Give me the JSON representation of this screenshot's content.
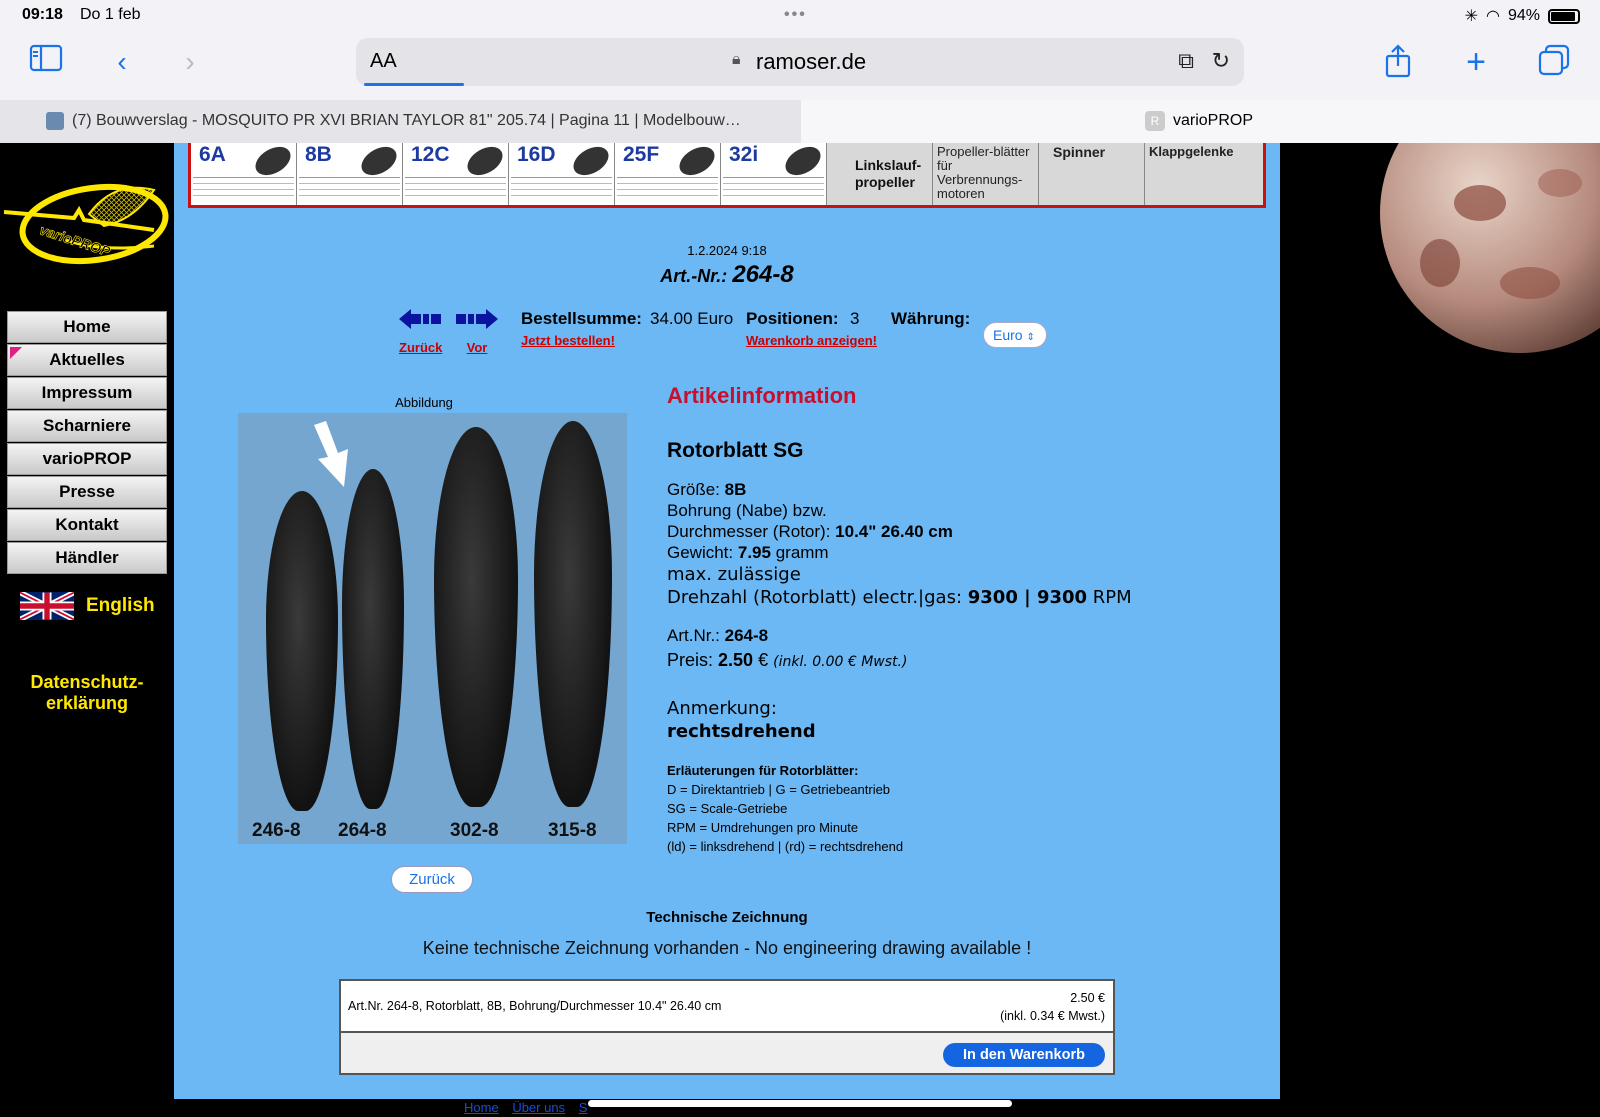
{
  "status": {
    "time": "09:18",
    "date": "Do 1 feb",
    "battery": "94%"
  },
  "browser": {
    "aa": "AA",
    "url": "ramoser.de",
    "tab1_title": "(7) Bouwverslag - MOSQUITO PR XVI BRIAN TAYLOR 81\" 205.74 | Pagina 11 | Modelbouw…",
    "tab2_fav": "R",
    "tab2_title": "varioPROP"
  },
  "sidebar": {
    "logo_text": "varioPROP",
    "items": [
      {
        "label": "Home"
      },
      {
        "label": "Aktuelles"
      },
      {
        "label": "Impressum"
      },
      {
        "label": "Scharniere"
      },
      {
        "label": "varioPROP"
      },
      {
        "label": "Presse"
      },
      {
        "label": "Kontakt"
      },
      {
        "label": "Händler"
      }
    ],
    "english": "English",
    "privacy": "Datenschutz-erklärung"
  },
  "banner": {
    "cells": [
      "6A",
      "8B",
      "12C",
      "16D",
      "25F",
      "32i"
    ],
    "linkslauf": "Linkslauf-propeller",
    "blades_gas": "Propeller-blätter für Verbrennungs-motoren",
    "spinner": "Spinner",
    "klapp": "Klappgelenke"
  },
  "header": {
    "datetime": "1.2.2024 9:18",
    "artnr_label": "Art.-Nr.:",
    "artnr_value": "264-8"
  },
  "orderbar": {
    "back": "Zurück",
    "forward": "Vor",
    "sum_label": "Bestellsumme:",
    "sum_value": "34.00 Euro",
    "order_link": "Jetzt bestellen!",
    "pos_label": "Positionen:",
    "pos_value": "3",
    "cart_link": "Warenkorb anzeigen!",
    "currency_label": "Währung:",
    "currency_value": "Euro"
  },
  "image": {
    "label": "Abbildung",
    "blade_labels": [
      "246-8",
      "264-8",
      "302-8",
      "315-8"
    ],
    "back_button": "Zurück"
  },
  "info": {
    "heading": "Artikelinformation",
    "name": "Rotorblatt SG",
    "size_label": "Größe:",
    "size_value": "8B",
    "bore_label": "Bohrung (Nabe) bzw.",
    "diam_label": "Durchmesser (Rotor):",
    "diam_value": "10.4\" 26.40 cm",
    "weight_label": "Gewicht:",
    "weight_value": "7.95",
    "weight_unit": "gramm",
    "rpm_label1": "max. zulässige",
    "rpm_label2": "Drehzahl (Rotorblatt) electr.|gas:",
    "rpm_value": "9300 | 9300",
    "rpm_unit": "RPM",
    "artnr_label": "Art.Nr.:",
    "artnr_value": "264-8",
    "price_label": "Preis:",
    "price_value": "2.50",
    "price_currency": "€",
    "price_tax": "(inkl. 0.00 € Mwst.)",
    "note_label": "Anmerkung:",
    "note_value": "rechtsdrehend",
    "legend_title": "Erläuterungen für Rotorblätter:",
    "legend": [
      "D = Direktantrieb | G = Getriebeantrieb",
      "SG = Scale-Getriebe",
      "RPM = Umdrehungen pro Minute",
      "(ld) = linksdrehend | (rd) = rechtsdrehend"
    ]
  },
  "tech": {
    "heading": "Technische Zeichnung",
    "note": "Keine technische Zeichnung vorhanden - No engineering drawing available !"
  },
  "cart": {
    "desc": "Art.Nr. 264-8, Rotorblatt, 8B, Bohrung/Durchmesser 10.4\" 26.40 cm",
    "price": "2.50 €",
    "tax": "(inkl. 0.34 € Mwst.)",
    "button": "In den Warenkorb"
  },
  "footer": [
    "Home",
    "Über uns",
    "S",
    "",
    "",
    "",
    "",
    ""
  ]
}
